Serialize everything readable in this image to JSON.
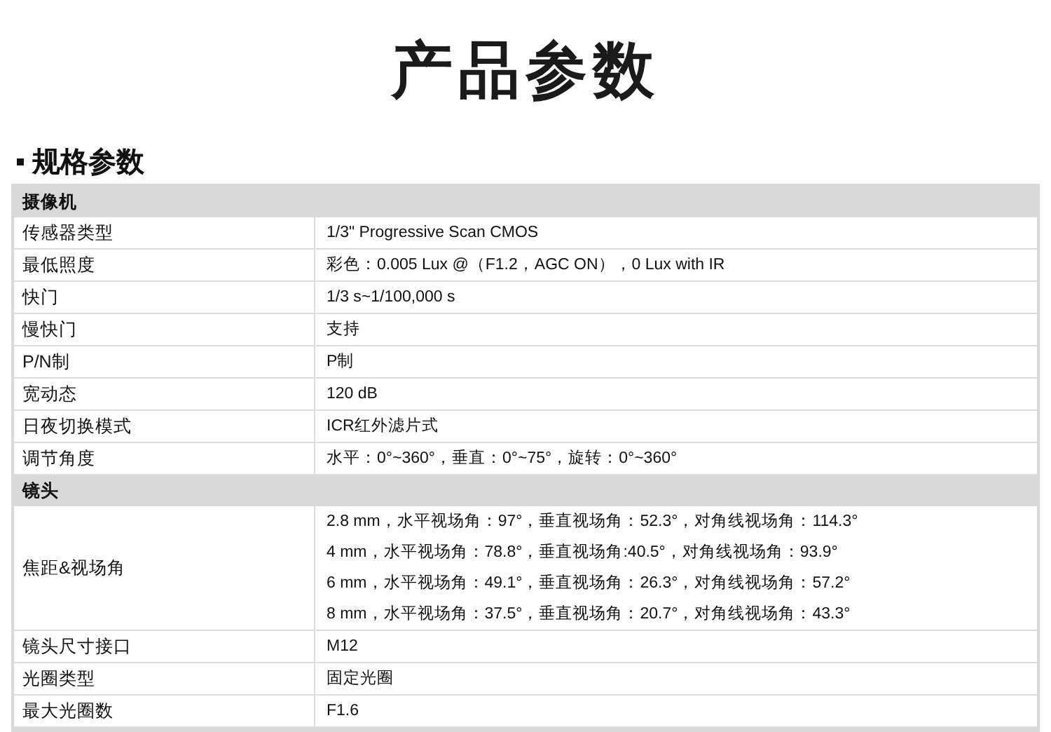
{
  "page_title": "产品参数",
  "section_title": "规格参数",
  "groups": [
    {
      "name": "摄像机",
      "rows": [
        {
          "label": "传感器类型",
          "values": [
            "1/3\" Progressive Scan CMOS"
          ]
        },
        {
          "label": "最低照度",
          "values": [
            "彩色：0.005 Lux @（F1.2，AGC ON），0 Lux with IR"
          ]
        },
        {
          "label": "快门",
          "values": [
            "1/3 s~1/100,000 s"
          ]
        },
        {
          "label": "慢快门",
          "values": [
            "支持"
          ]
        },
        {
          "label": "P/N制",
          "values": [
            "P制"
          ]
        },
        {
          "label": "宽动态",
          "values": [
            "120 dB"
          ]
        },
        {
          "label": "日夜切换模式",
          "values": [
            "ICR红外滤片式"
          ]
        },
        {
          "label": "调节角度",
          "values": [
            "水平：0°~360°，垂直：0°~75°，旋转：0°~360°"
          ]
        }
      ]
    },
    {
      "name": "镜头",
      "rows": [
        {
          "label": "焦距&视场角",
          "values": [
            "2.8 mm，水平视场角：97°，垂直视场角：52.3°，对角线视场角：114.3°",
            "4 mm，水平视场角：78.8°，垂直视场角:40.5°，对角线视场角：93.9°",
            "6 mm，水平视场角：49.1°，垂直视场角：26.3°，对角线视场角：57.2°",
            "8 mm，水平视场角：37.5°，垂直视场角：20.7°，对角线视场角：43.3°"
          ]
        },
        {
          "label": "镜头尺寸接口",
          "values": [
            "M12"
          ]
        },
        {
          "label": "光圈类型",
          "values": [
            "固定光圈"
          ]
        },
        {
          "label": "最大光圈数",
          "values": [
            "F1.6"
          ]
        }
      ]
    }
  ]
}
